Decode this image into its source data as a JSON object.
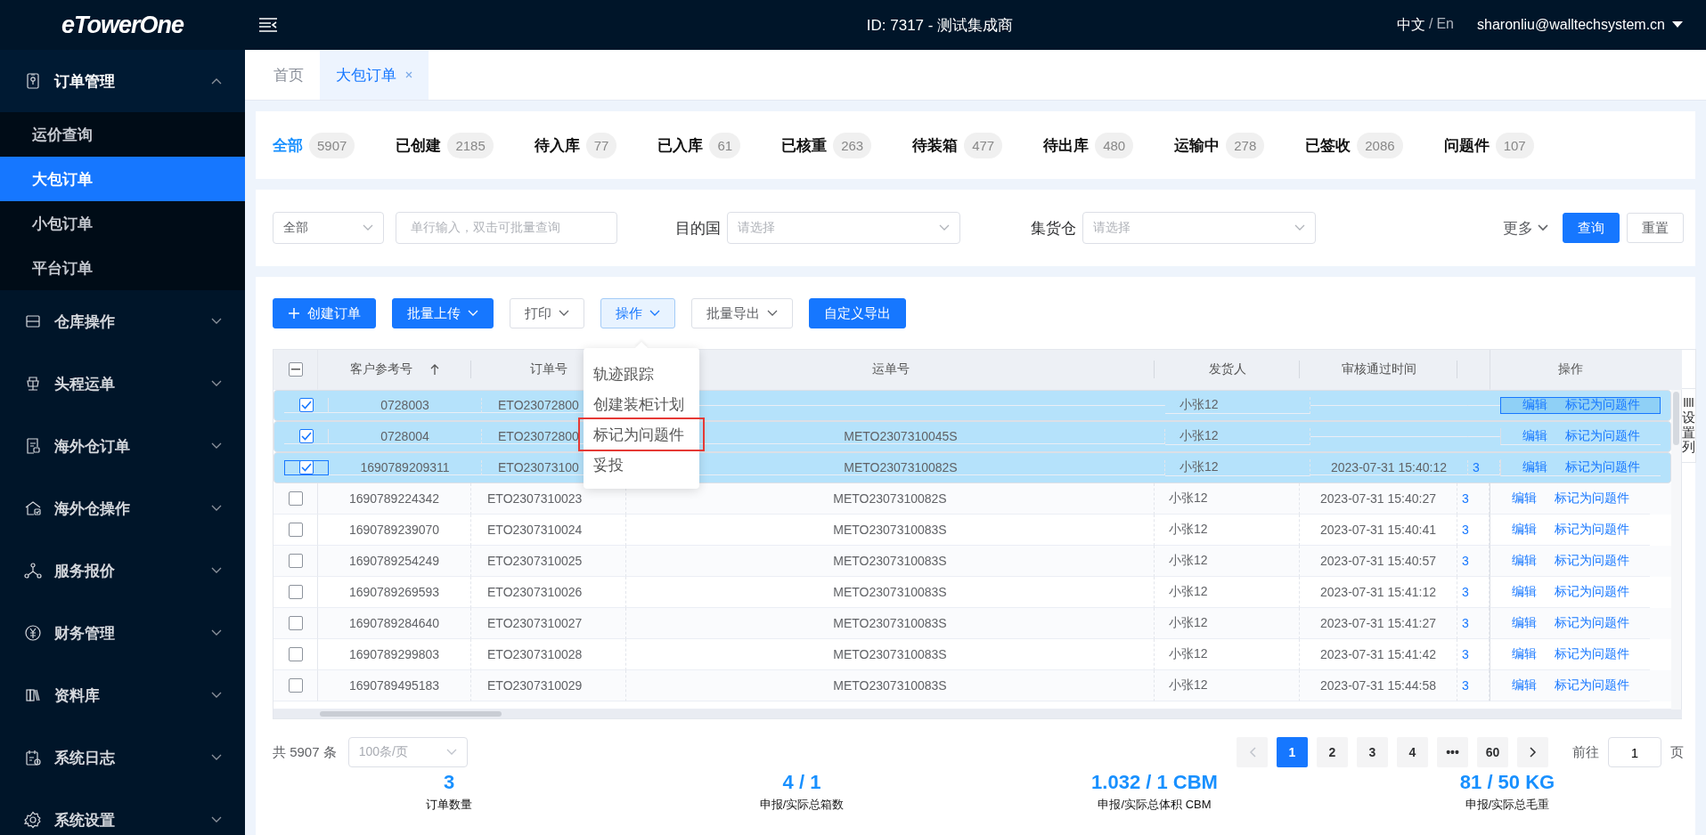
{
  "top_bar": {
    "logo": "eTowerOne",
    "title": "ID: 7317 - 测试集成商",
    "languages": [
      {
        "label": "中文",
        "selected": true
      },
      {
        "label": "En",
        "selected": false
      }
    ],
    "separator": "/",
    "user": "sharonliu@walltechsystem.cn"
  },
  "sidebar": {
    "items": [
      {
        "label": "订单管理",
        "expanded": true,
        "children": [
          {
            "label": "运价查询",
            "selected": false
          },
          {
            "label": "大包订单",
            "selected": true
          },
          {
            "label": "小包订单",
            "selected": false
          },
          {
            "label": "平台订单",
            "selected": false
          }
        ]
      },
      {
        "label": "仓库操作",
        "expanded": false
      },
      {
        "label": "头程运单",
        "expanded": false
      },
      {
        "label": "海外仓订单",
        "expanded": false
      },
      {
        "label": "海外仓操作",
        "expanded": false
      },
      {
        "label": "服务报价",
        "expanded": false
      },
      {
        "label": "财务管理",
        "expanded": false
      },
      {
        "label": "资料库",
        "expanded": false
      },
      {
        "label": "系统日志",
        "expanded": false
      },
      {
        "label": "系统设置",
        "expanded": false
      }
    ]
  },
  "page_tabs": [
    {
      "label": "首页",
      "selected": false,
      "closable": false
    },
    {
      "label": "大包订单",
      "selected": true,
      "closable": true
    }
  ],
  "status_tabs": [
    {
      "label": "全部",
      "count": "5907",
      "selected": true
    },
    {
      "label": "已创建",
      "count": "2185",
      "selected": false
    },
    {
      "label": "待入库",
      "count": "77",
      "selected": false
    },
    {
      "label": "已入库",
      "count": "61",
      "selected": false
    },
    {
      "label": "已核重",
      "count": "263",
      "selected": false
    },
    {
      "label": "待装箱",
      "count": "477",
      "selected": false
    },
    {
      "label": "待出库",
      "count": "480",
      "selected": false
    },
    {
      "label": "运输中",
      "count": "278",
      "selected": false
    },
    {
      "label": "已签收",
      "count": "2086",
      "selected": false
    },
    {
      "label": "问题件",
      "count": "107",
      "selected": false
    }
  ],
  "filters": {
    "scope_select": {
      "value": "全部"
    },
    "search": {
      "placeholder": "单行输入，双击可批量查询"
    },
    "destination": {
      "label": "目的国",
      "placeholder": "请选择"
    },
    "warehouse": {
      "label": "集货仓",
      "placeholder": "请选择"
    },
    "more": "更多",
    "search_button": "查询",
    "reset_button": "重置"
  },
  "toolbar": [
    {
      "label": "创建订单",
      "kind": "primary",
      "plus": true,
      "dropdown": false,
      "selected": false
    },
    {
      "label": "批量上传",
      "kind": "primary",
      "plus": false,
      "dropdown": true,
      "selected": false
    },
    {
      "label": "打印",
      "kind": "default",
      "plus": false,
      "dropdown": true,
      "selected": false
    },
    {
      "label": "操作",
      "kind": "default",
      "plus": false,
      "dropdown": true,
      "selected": true
    },
    {
      "label": "批量导出",
      "kind": "default",
      "plus": false,
      "dropdown": true,
      "selected": false
    },
    {
      "label": "自定义导出",
      "kind": "primary",
      "plus": false,
      "dropdown": false,
      "selected": false
    }
  ],
  "action_menu": {
    "items": [
      {
        "label": "轨迹跟踪",
        "highlighted": false
      },
      {
        "label": "创建装柜计划",
        "highlighted": false
      },
      {
        "label": "标记为问题件",
        "highlighted": true
      },
      {
        "label": "妥投",
        "highlighted": false
      }
    ]
  },
  "table": {
    "header_checkbox": {
      "checked": false,
      "indeterminate": true
    },
    "columns": [
      {
        "label": "客户参考号",
        "sorted": true
      },
      {
        "label": "订单号",
        "sorted": false
      },
      {
        "label": "运单号",
        "sorted": false
      },
      {
        "label": "发货人",
        "sorted": false
      },
      {
        "label": "审核通过时间",
        "sorted": false
      },
      {
        "label": "操作",
        "sorted": false
      }
    ],
    "rows": [
      {
        "checked": true,
        "selected": true,
        "checkbox_focused": false,
        "actions_focused": true,
        "customer_ref": "0728003",
        "order_no": "ETO23072800",
        "shipper": "小张12",
        "actions": [
          "编辑",
          "标记为问题件"
        ]
      },
      {
        "checked": true,
        "selected": true,
        "checkbox_focused": false,
        "actions_focused": false,
        "customer_ref": "0728004",
        "order_no": "ETO23072800",
        "waybill": "METO2307310045S",
        "shipper": "小张12",
        "actions": [
          "编辑",
          "标记为问题件"
        ]
      },
      {
        "checked": true,
        "selected": true,
        "checkbox_focused": true,
        "actions_focused": false,
        "customer_ref": "1690789209311",
        "order_no": "ETO23073100",
        "waybill": "METO2307310082S",
        "shipper": "小张12",
        "audit_time": "2023-07-31 15:40:12",
        "column_7": "3",
        "actions": [
          "编辑",
          "标记为问题件"
        ]
      },
      {
        "checked": false,
        "selected": false,
        "checkbox_focused": false,
        "actions_focused": false,
        "customer_ref": "1690789224342",
        "order_no": "ETO2307310023",
        "waybill": "METO2307310082S",
        "shipper": "小张12",
        "audit_time": "2023-07-31 15:40:27",
        "column_7": "3",
        "actions": [
          "编辑",
          "标记为问题件"
        ]
      },
      {
        "checked": false,
        "selected": false,
        "checkbox_focused": false,
        "actions_focused": false,
        "customer_ref": "1690789239070",
        "order_no": "ETO2307310024",
        "waybill": "METO2307310083S",
        "shipper": "小张12",
        "audit_time": "2023-07-31 15:40:41",
        "column_7": "3",
        "actions": [
          "编辑",
          "标记为问题件"
        ]
      },
      {
        "checked": false,
        "selected": false,
        "checkbox_focused": false,
        "actions_focused": false,
        "customer_ref": "1690789254249",
        "order_no": "ETO2307310025",
        "waybill": "METO2307310083S",
        "shipper": "小张12",
        "audit_time": "2023-07-31 15:40:57",
        "column_7": "3",
        "actions": [
          "编辑",
          "标记为问题件"
        ]
      },
      {
        "checked": false,
        "selected": false,
        "checkbox_focused": false,
        "actions_focused": false,
        "customer_ref": "1690789269593",
        "order_no": "ETO2307310026",
        "waybill": "METO2307310083S",
        "shipper": "小张12",
        "audit_time": "2023-07-31 15:41:12",
        "column_7": "3",
        "actions": [
          "编辑",
          "标记为问题件"
        ]
      },
      {
        "checked": false,
        "selected": false,
        "checkbox_focused": false,
        "actions_focused": false,
        "customer_ref": "1690789284640",
        "order_no": "ETO2307310027",
        "waybill": "METO2307310083S",
        "shipper": "小张12",
        "audit_time": "2023-07-31 15:41:27",
        "column_7": "3",
        "actions": [
          "编辑",
          "标记为问题件"
        ]
      },
      {
        "checked": false,
        "selected": false,
        "checkbox_focused": false,
        "actions_focused": false,
        "customer_ref": "1690789299803",
        "order_no": "ETO2307310028",
        "waybill": "METO2307310083S",
        "shipper": "小张12",
        "audit_time": "2023-07-31 15:41:42",
        "column_7": "3",
        "actions": [
          "编辑",
          "标记为问题件"
        ]
      },
      {
        "checked": false,
        "selected": false,
        "checkbox_focused": false,
        "actions_focused": false,
        "customer_ref": "1690789495183",
        "order_no": "ETO2307310029",
        "waybill": "METO2307310083S",
        "shipper": "小张12",
        "audit_time": "2023-07-31 15:44:58",
        "column_7": "3",
        "actions": [
          "编辑",
          "标记为问题件"
        ]
      }
    ]
  },
  "column_settings": {
    "label": "设置列"
  },
  "pagination": {
    "total": "共 5907 条",
    "page_size": {
      "value": "100条/页",
      "disabled": true
    },
    "prev_disabled": true,
    "next_disabled": false,
    "pages": [
      {
        "label": "1",
        "selected": true
      },
      {
        "label": "2",
        "selected": false
      },
      {
        "label": "3",
        "selected": false
      },
      {
        "label": "4",
        "selected": false
      },
      {
        "label": "•••",
        "selected": false
      },
      {
        "label": "60",
        "selected": false
      }
    ],
    "goto_label": "前往",
    "goto_value": "1",
    "page_suffix": "页"
  },
  "summary": [
    {
      "value": "3",
      "label": "订单数量"
    },
    {
      "value": "4 / 1",
      "label": "申报/实际总箱数"
    },
    {
      "value": "1.032 / 1 CBM",
      "label": "申报/实际总体积 CBM"
    },
    {
      "value": "81 / 50 KG",
      "label": "申报/实际总毛重"
    }
  ]
}
